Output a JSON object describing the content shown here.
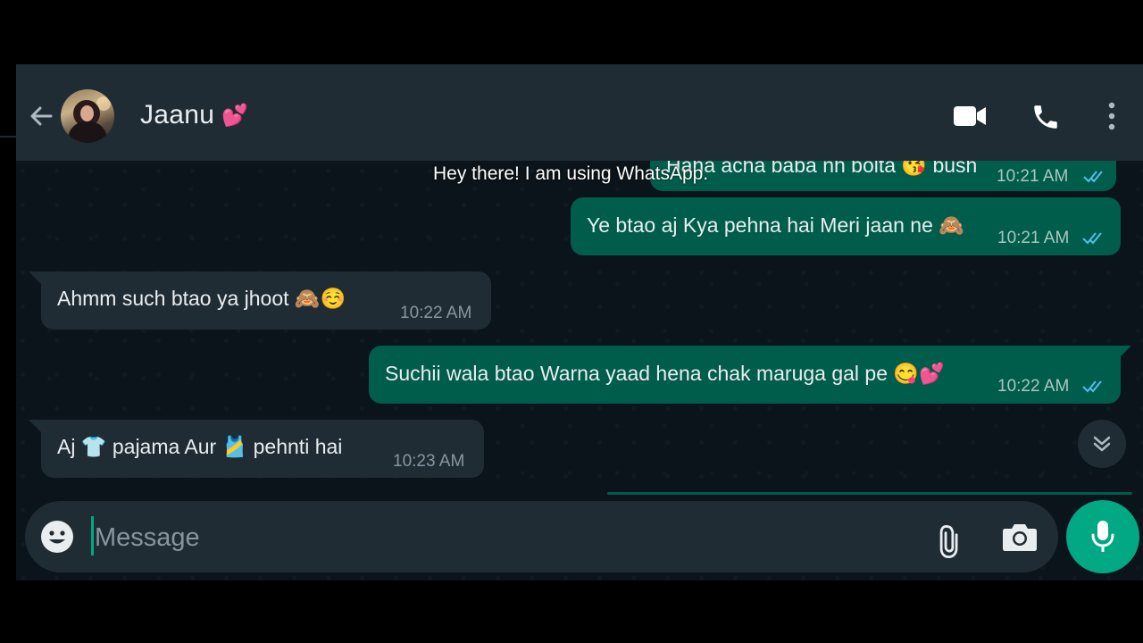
{
  "header": {
    "contact_name": "Jaanu",
    "name_emoji": "💕",
    "back_icon": "arrow-left-icon",
    "video_icon": "video-call-icon",
    "call_icon": "voice-call-icon",
    "menu_icon": "more-vertical-icon"
  },
  "overlay_status": "Hey there! I am using WhatsApp.",
  "messages": [
    {
      "direction": "out",
      "text": "Haha acha baba nh bolta 😘 bush",
      "time": "10:21 AM",
      "ticks": "read"
    },
    {
      "direction": "out",
      "text": "Ye btao aj Kya pehna hai Meri jaan ne 🙈",
      "time": "10:21 AM",
      "ticks": "read"
    },
    {
      "direction": "in",
      "text": "Ahmm such btao ya jhoot 🙈☺️",
      "time": "10:22 AM"
    },
    {
      "direction": "out",
      "text": "Suchii wala btao Warna yaad hena chak maruga gal pe 😋💕",
      "time": "10:22 AM",
      "ticks": "read"
    },
    {
      "direction": "in",
      "text": "Aj 👕 pajama Aur 🎽 pehnti hai",
      "time": "10:23 AM"
    }
  ],
  "composer": {
    "placeholder": "Message",
    "value": ""
  },
  "colors": {
    "header_bg": "#202c33",
    "chat_bg": "#0b141a",
    "incoming_bubble": "#202c33",
    "outgoing_bubble": "#005c4b",
    "accent": "#00a884",
    "read_tick": "#53bdeb"
  }
}
